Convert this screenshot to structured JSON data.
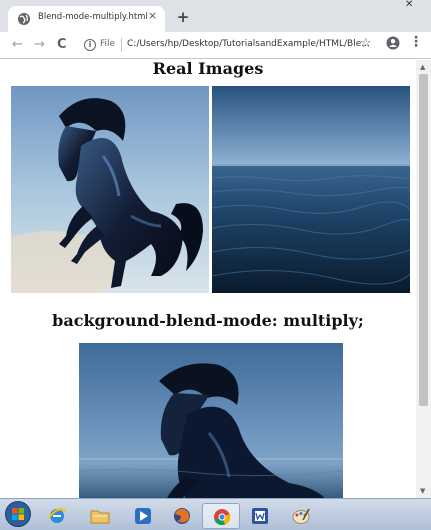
{
  "browser": {
    "tab_title": "Blend-mode-multiply.html",
    "tab_close": "×",
    "new_tab": "+",
    "window_close": "✕",
    "back": "←",
    "forward": "→",
    "reload": "C",
    "info_icon": "i",
    "address_scheme": "File",
    "address_url": "C:/Users/hp/Desktop/TutorialsandExample/HTML/Ble...",
    "bookmark": "☆",
    "menu": "⋮"
  },
  "page": {
    "heading_real": "Real Images",
    "heading_blend": "background-blend-mode: multiply;"
  },
  "scroll": {
    "up": "▲",
    "down": "▼"
  },
  "taskbar": {
    "items": [
      "start-orb",
      "internet-explorer",
      "file-explorer",
      "media-player",
      "firefox",
      "chrome",
      "word",
      "paint"
    ]
  },
  "colors": {
    "tabstrip": "#dee1e6",
    "sky": "#9fc0dc",
    "sea": "#163a5c",
    "horse": "#0f1a2c"
  }
}
